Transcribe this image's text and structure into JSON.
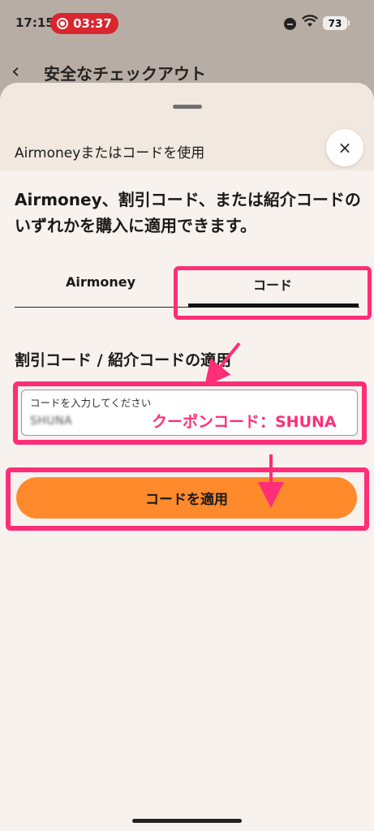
{
  "status_bar": {
    "time": "17:15",
    "recording_time": "03:37",
    "battery": "73"
  },
  "behind": {
    "title": "安全なチェックアウト"
  },
  "sheet": {
    "title": "Airmoneyまたはコードを使用",
    "close": "×",
    "description": "Airmoney、割引コード、または紹介コードのいずれかを購入に適用できます。",
    "tabs": [
      {
        "label": "Airmoney",
        "selected": false
      },
      {
        "label": "コード",
        "selected": true
      }
    ],
    "section_label": "割引コード / 紹介コードの適用",
    "input": {
      "label": "コードを入力してください",
      "value": "SHUNA"
    },
    "annotation": "クーポンコード：SHUNA",
    "apply_button": "コードを適用"
  },
  "colors": {
    "highlight": "#ff2e77",
    "button": "#ff8a2c",
    "record": "#d9262f"
  },
  "icons": [
    "record-icon",
    "do-not-disturb-icon",
    "wifi-icon",
    "battery-icon",
    "back-arrow-icon",
    "close-icon"
  ]
}
